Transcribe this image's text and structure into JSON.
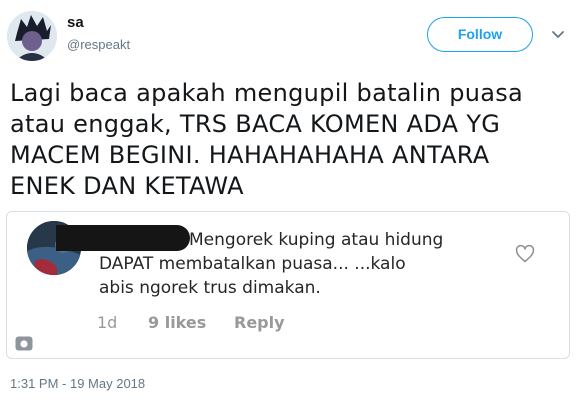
{
  "author": {
    "display_name": "sa",
    "handle": "@respeakt"
  },
  "follow_label": "Follow",
  "tweet": {
    "text": "Lagi baca apakah mengupil batalin puasa\natau enggak, TRS BACA KOMEN ADA YG\nMACEM BEGINI. HAHAHAHAHA ANTARA\nENEK DAN KETAWA",
    "timestamp": "1:31 PM - 19 May 2018"
  },
  "embedded_comment": {
    "line1": "Mengorek kuping atau hidung",
    "line2": "DAPAT membatalkan puasa... ...kalo",
    "line3": "abis ngorek trus dimakan.",
    "age": "1d",
    "likes": "9 likes",
    "reply_label": "Reply"
  },
  "colors": {
    "accent": "#1da1f2",
    "text": "#14171a",
    "muted": "#657786"
  }
}
